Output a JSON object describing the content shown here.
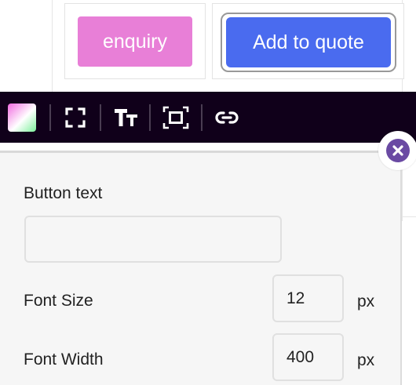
{
  "buttons": {
    "enquiry_label": "enquiry",
    "quote_label": "Add to quote"
  },
  "toolbar": {
    "tools": [
      "color-swatch",
      "fullscreen-icon",
      "text-size-icon",
      "fit-frame-icon",
      "link-icon"
    ]
  },
  "panel": {
    "button_text_label": "Button text",
    "button_text_value": "",
    "font_size_label": "Font Size",
    "font_size_value": "12",
    "font_size_unit": "px",
    "font_width_label": "Font Width",
    "font_width_value": "400",
    "font_width_unit": "px"
  },
  "colors": {
    "enquiry_bg": "#e87fd7",
    "quote_bg": "#4a6bef",
    "toolbar_bg": "#10001a",
    "close_bg": "#6a4aa3"
  }
}
